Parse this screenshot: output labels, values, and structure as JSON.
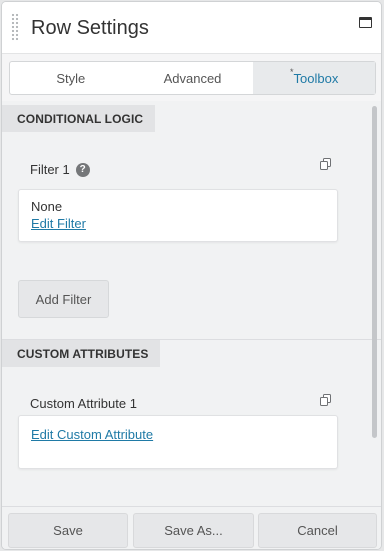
{
  "header": {
    "title": "Row Settings"
  },
  "tabs": [
    {
      "label": "Style",
      "marker": ""
    },
    {
      "label": "Advanced",
      "marker": ""
    },
    {
      "label": "Toolbox",
      "marker": "*"
    }
  ],
  "sections": {
    "conditional_logic": {
      "label": "CONDITIONAL LOGIC",
      "filter_label": "Filter 1",
      "help_glyph": "?",
      "filter_value": "None",
      "edit_link": "Edit Filter",
      "add_button": "Add Filter"
    },
    "custom_attributes": {
      "label": "CUSTOM ATTRIBUTES",
      "attribute_label": "Custom Attribute 1",
      "edit_link": "Edit Custom Attribute"
    }
  },
  "footer": {
    "save": "Save",
    "save_as": "Save As...",
    "cancel": "Cancel"
  },
  "colors": {
    "accent": "#1f7aa6",
    "panel_bg": "#f1f2f3"
  }
}
